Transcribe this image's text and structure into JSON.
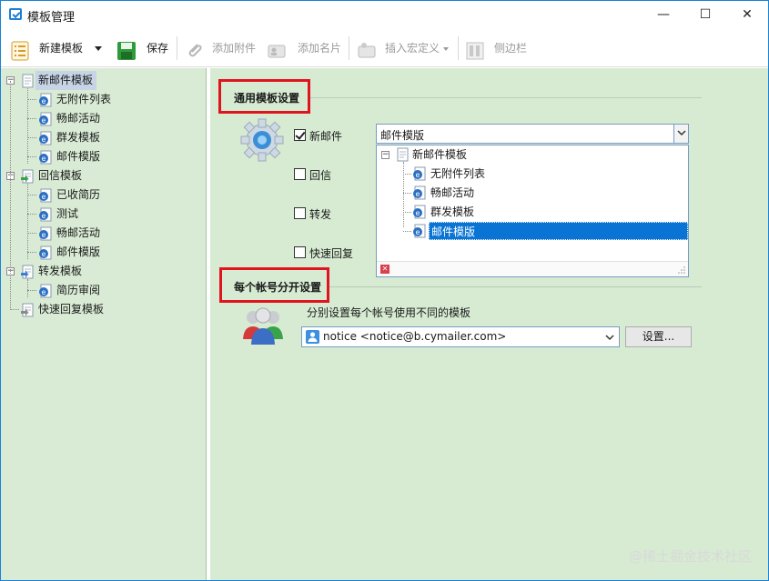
{
  "window": {
    "title": "模板管理",
    "minimize_glyph": "—",
    "maximize_glyph": "☐",
    "close_glyph": "✕"
  },
  "toolbar": {
    "new_template": "新建模板",
    "save": "保存",
    "add_attachment": "添加附件",
    "add_card": "添加名片",
    "insert_macro": "插入宏定义",
    "sidebar": "侧边栏"
  },
  "tree": {
    "groups": [
      {
        "label": "新邮件模板",
        "icon": "doc-icon",
        "children": [
          "无附件列表",
          "畅邮活动",
          "群发模板",
          "邮件模版"
        ]
      },
      {
        "label": "回信模板",
        "icon": "reply-icon",
        "children": [
          "已收简历",
          "测试",
          "畅邮活动",
          "邮件模版"
        ]
      },
      {
        "label": "转发模板",
        "icon": "forward-icon",
        "children": [
          "简历审阅"
        ]
      },
      {
        "label": "快速回复模板",
        "icon": "quick-reply-icon",
        "children": []
      }
    ]
  },
  "general_settings": {
    "title": "通用模板设置",
    "options": [
      {
        "label": "新邮件",
        "checked": true
      },
      {
        "label": "回信",
        "checked": false
      },
      {
        "label": "转发",
        "checked": false
      },
      {
        "label": "快速回复",
        "checked": false
      }
    ],
    "combo_value": "邮件模版",
    "dropdown_root": "新邮件模板",
    "dropdown_items": [
      "无附件列表",
      "畅邮活动",
      "群发模板",
      "邮件模版"
    ],
    "dropdown_selected_index": 3
  },
  "account_settings": {
    "title": "每个帐号分开设置",
    "description": "分别设置每个帐号使用不同的模板",
    "account_value": "notice <notice@b.cymailer.com>",
    "settings_button": "设置..."
  },
  "watermark": "@稀土掘金技术社区",
  "colors": {
    "accent": "#0a74d4",
    "highlight_box": "#e0141e",
    "pane_green": "#d6ebd2"
  }
}
